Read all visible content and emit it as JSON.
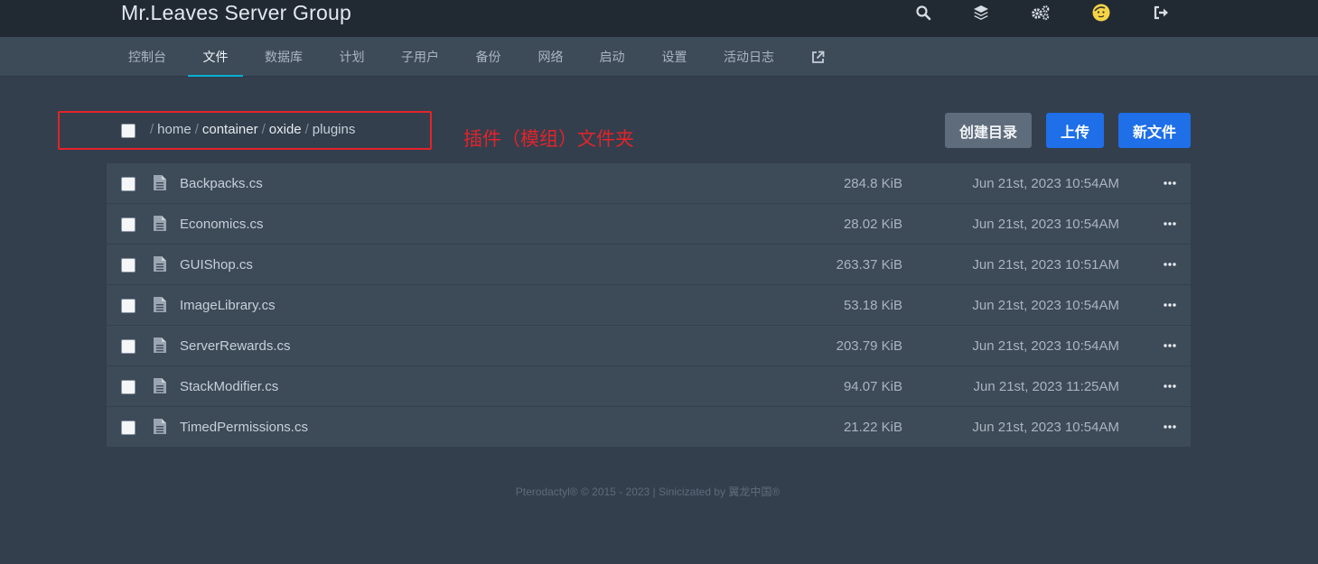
{
  "header": {
    "brand": "Mr.Leaves Server Group",
    "icons": [
      "search-icon",
      "layers-icon",
      "cogs-icon",
      "user-avatar-icon",
      "logout-icon"
    ]
  },
  "nav": {
    "items": [
      "控制台",
      "文件",
      "数据库",
      "计划",
      "子用户",
      "备份",
      "网络",
      "启动",
      "设置",
      "活动日志"
    ],
    "active": "文件",
    "external_icon": "external-link-icon"
  },
  "breadcrumb": {
    "parts": [
      "home",
      "container",
      "oxide",
      "plugins"
    ]
  },
  "annotation": {
    "text": "插件（模组）文件夹",
    "color": "#e3232b"
  },
  "actions": {
    "create_directory": "创建目录",
    "upload": "上传",
    "new_file": "新文件"
  },
  "files": [
    {
      "name": "Backpacks.cs",
      "size": "284.8 KiB",
      "modified": "Jun 21st, 2023 10:54AM"
    },
    {
      "name": "Economics.cs",
      "size": "28.02 KiB",
      "modified": "Jun 21st, 2023 10:54AM"
    },
    {
      "name": "GUIShop.cs",
      "size": "263.37 KiB",
      "modified": "Jun 21st, 2023 10:51AM"
    },
    {
      "name": "ImageLibrary.cs",
      "size": "53.18 KiB",
      "modified": "Jun 21st, 2023 10:54AM"
    },
    {
      "name": "ServerRewards.cs",
      "size": "203.79 KiB",
      "modified": "Jun 21st, 2023 10:54AM"
    },
    {
      "name": "StackModifier.cs",
      "size": "94.07 KiB",
      "modified": "Jun 21st, 2023 11:25AM"
    },
    {
      "name": "TimedPermissions.cs",
      "size": "21.22 KiB",
      "modified": "Jun 21st, 2023 10:54AM"
    }
  ],
  "footer": {
    "text": "Pterodactyl® © 2015 - 2023 | Sinicizated by 翼龙中国®"
  },
  "colors": {
    "accent": "#06b0d1",
    "primary_button": "#1e6fe8",
    "secondary_button": "#5f6c7b",
    "background": "#333f4d",
    "topbar": "#212a33"
  }
}
